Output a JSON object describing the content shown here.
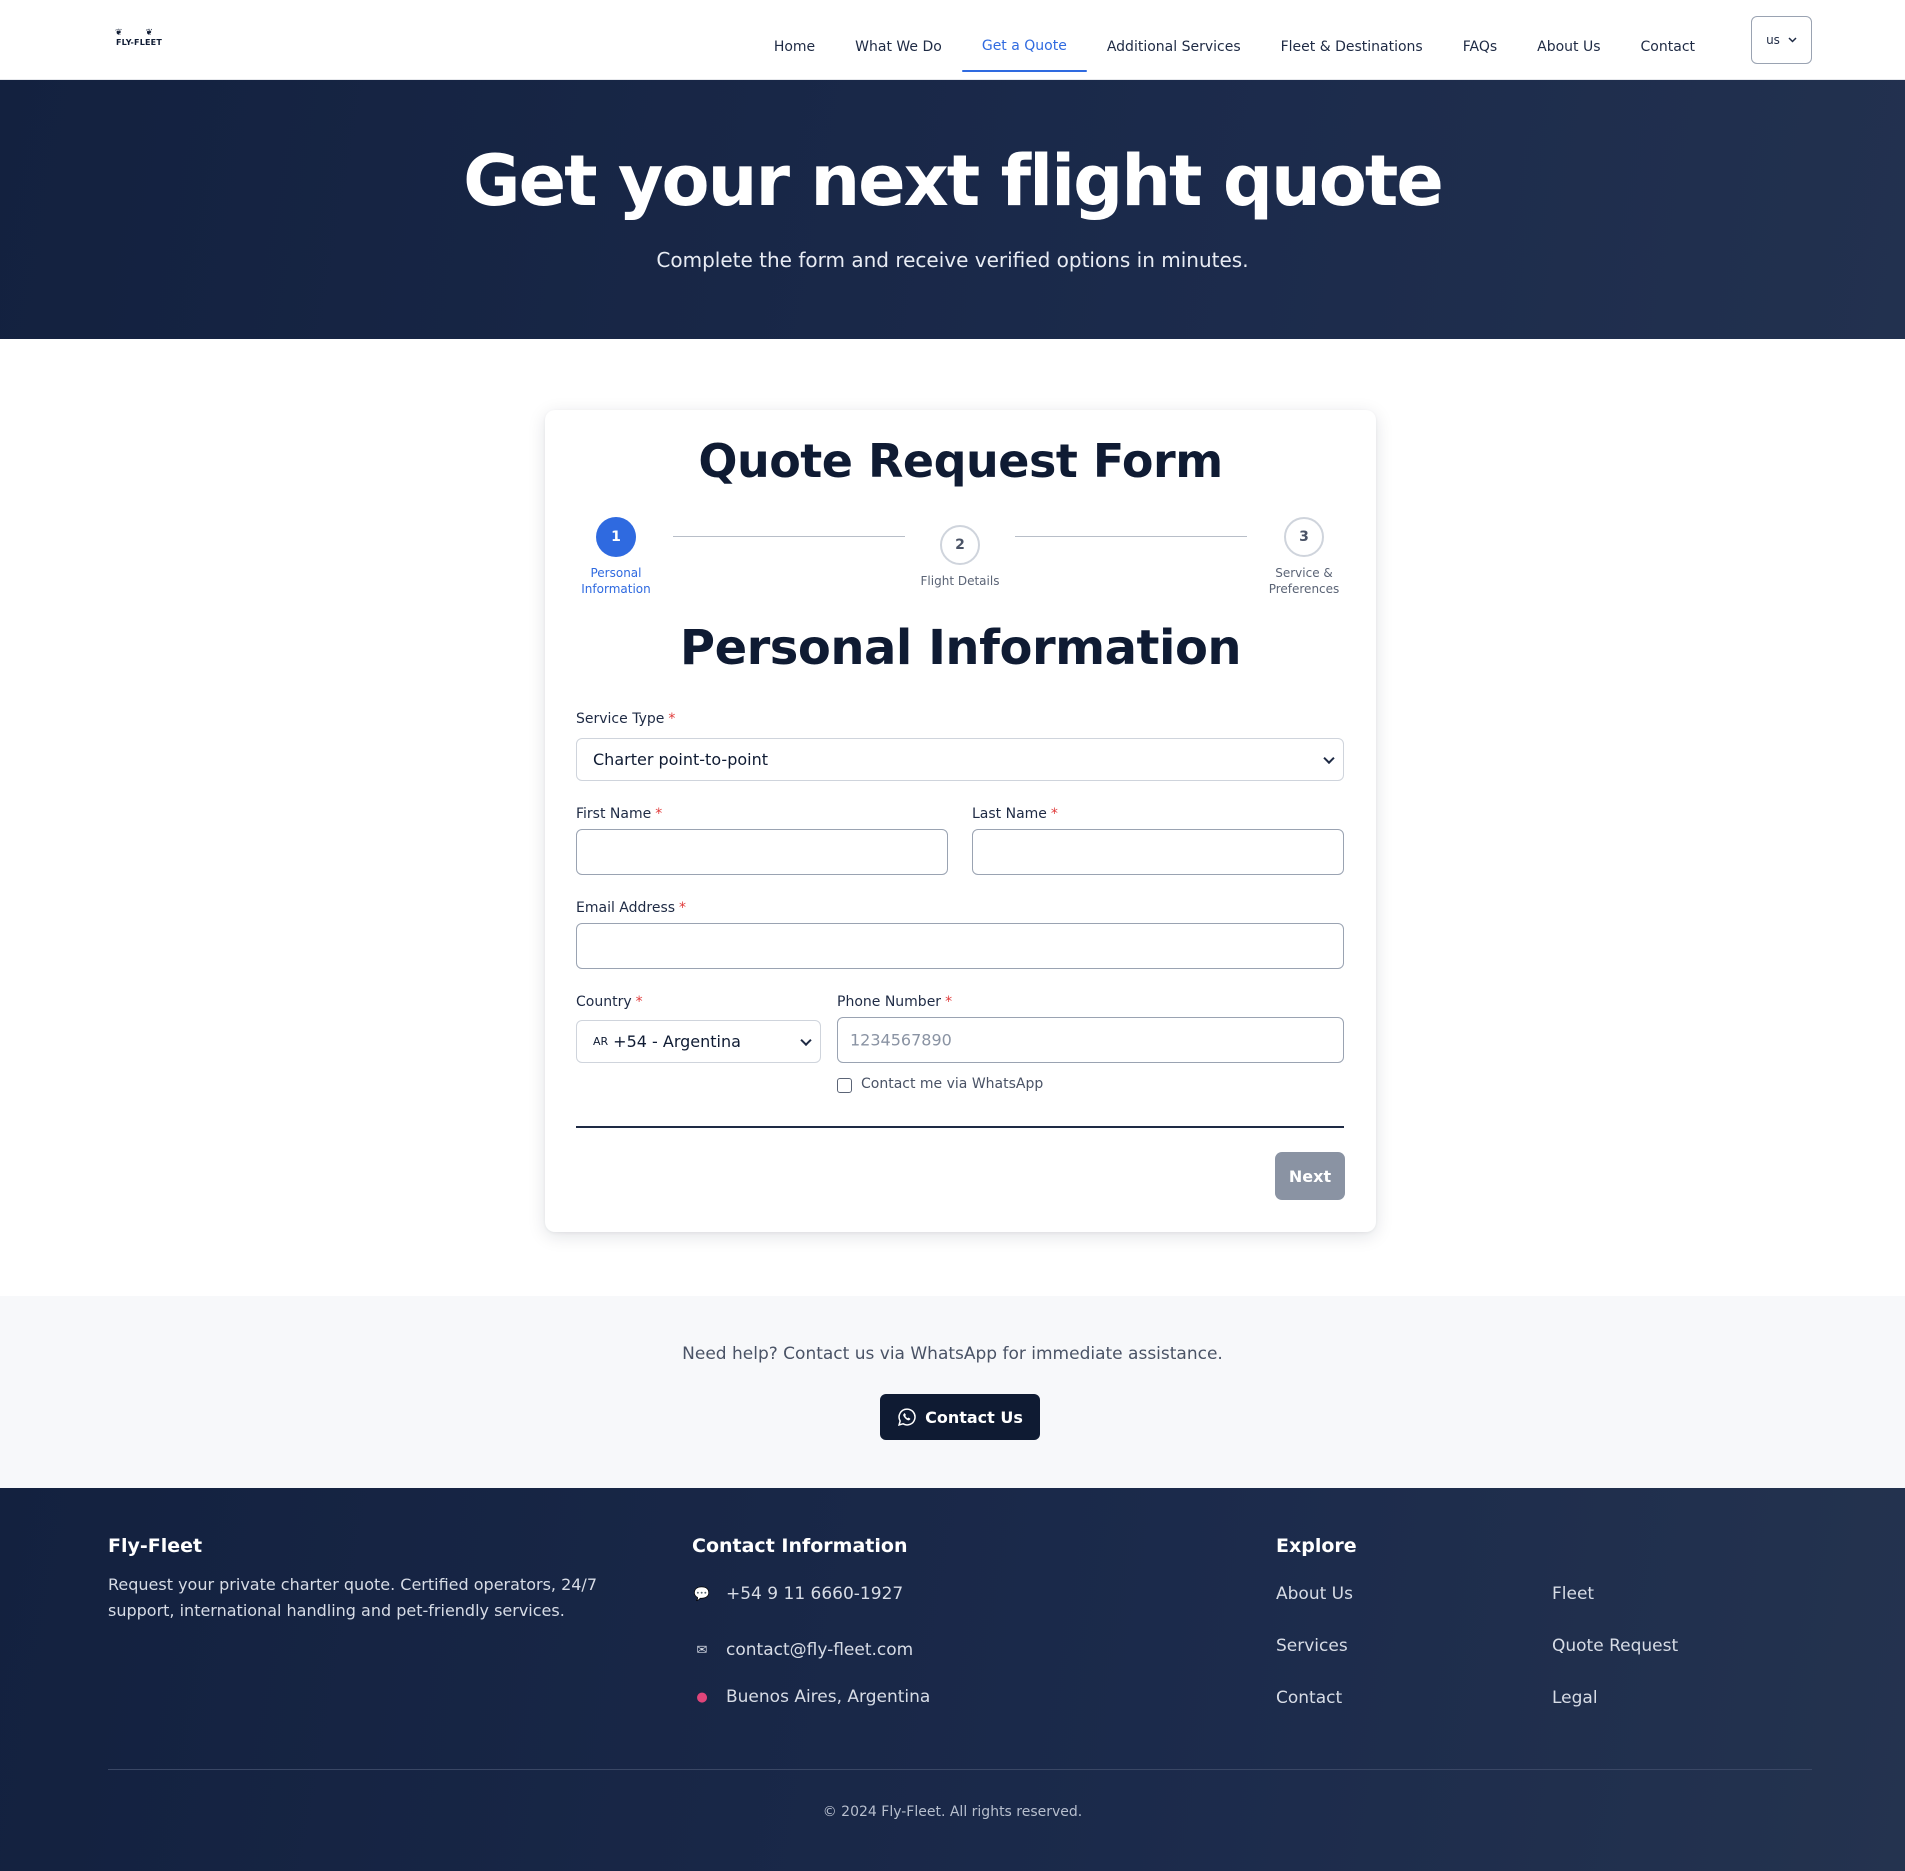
{
  "brand": {
    "logo_text": "FLY-FLEET",
    "logo_wings": "❦ ❦"
  },
  "nav": {
    "items": [
      {
        "label": "Home"
      },
      {
        "label": "What We Do"
      },
      {
        "label": "Get a Quote",
        "active": true
      },
      {
        "label": "Additional Services"
      },
      {
        "label": "Fleet & Destinations"
      },
      {
        "label": "FAQs"
      },
      {
        "label": "About Us"
      },
      {
        "label": "Contact"
      }
    ],
    "language": "us"
  },
  "hero": {
    "title": "Get your next flight quote",
    "subtitle": "Complete the form and receive verified options in minutes."
  },
  "form": {
    "title": "Quote Request Form",
    "steps": [
      {
        "number": "1",
        "label_line1": "Personal",
        "label_line2": "Information",
        "active": true
      },
      {
        "number": "2",
        "label_line1": "Flight Details",
        "label_line2": "",
        "active": false
      },
      {
        "number": "3",
        "label_line1": "Service &",
        "label_line2": "Preferences",
        "active": false
      }
    ],
    "section_title": "Personal Information",
    "required_mark": "*",
    "service_type": {
      "label": "Service Type",
      "value": "Charter point-to-point"
    },
    "first_name": {
      "label": "First Name",
      "value": ""
    },
    "last_name": {
      "label": "Last Name",
      "value": ""
    },
    "email": {
      "label": "Email Address",
      "value": ""
    },
    "country": {
      "label": "Country",
      "code": "AR",
      "value": "+54 - Argentina"
    },
    "phone": {
      "label": "Phone Number",
      "placeholder": "1234567890",
      "value": ""
    },
    "whatsapp_checkbox": {
      "label": "Contact me via WhatsApp",
      "checked": false
    },
    "next_label": "Next"
  },
  "help": {
    "text": "Need help? Contact us via WhatsApp for immediate assistance.",
    "button_label": "Contact Us"
  },
  "footer": {
    "brand_title": "Fly-Fleet",
    "description": "Request your private charter quote. Certified operators, 24/7 support, international handling and pet-friendly services.",
    "contact_title": "Contact Information",
    "contact": [
      {
        "icon": "chat-icon",
        "text": "+54 9 11 6660-1927"
      },
      {
        "icon": "envelope-icon",
        "text": "contact@fly-fleet.com"
      },
      {
        "icon": "pin-icon",
        "text": "Buenos Aires, Argentina"
      }
    ],
    "explore_title": "Explore",
    "explore_col1": [
      "About Us",
      "Services",
      "Contact"
    ],
    "explore_col2": [
      "Fleet",
      "Quote Request",
      "Legal"
    ],
    "copyright": "© 2024 Fly-Fleet. All rights reserved."
  },
  "colors": {
    "accent": "#2f6ae0",
    "navy": "#0f1b33",
    "required": "#e03a3a",
    "disabled_button": "#8a93a3"
  }
}
